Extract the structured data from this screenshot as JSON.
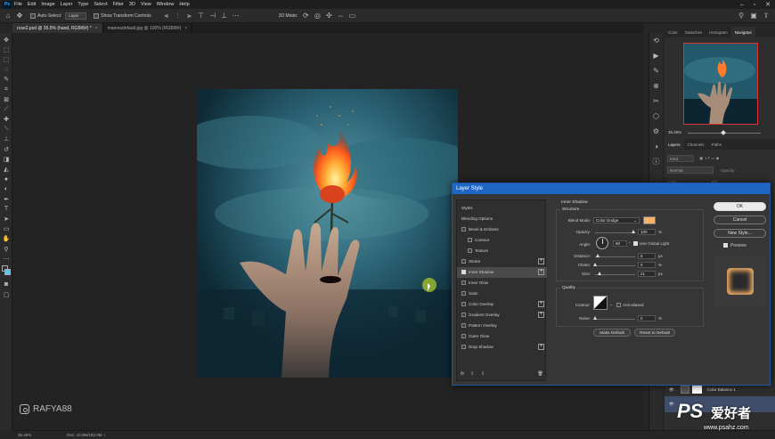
{
  "app": {
    "name": "Ps"
  },
  "menu": [
    "File",
    "Edit",
    "Image",
    "Layer",
    "Type",
    "Select",
    "Filter",
    "3D",
    "View",
    "Window",
    "Help"
  ],
  "options": {
    "auto_select": "Auto-Select:",
    "layer_select": "Layer",
    "transform": "Show Transform Controls",
    "mode3d": "3D Mode:"
  },
  "tabs": [
    {
      "label": "rose2.psd @ 35.5% (hand, RGB/8#) *"
    },
    {
      "label": "maxresdefault.jpg @ 100% (RGB/8#)"
    }
  ],
  "watermark": "RAFYA88",
  "status": {
    "zoom": "35.46%",
    "doc": "Doc: 10.9M/182.0M"
  },
  "panels": {
    "tabs": [
      "Color",
      "Swatches",
      "Histogram",
      "Navigator"
    ],
    "nav_zoom": "35.46%",
    "layer_tabs": [
      "Layers",
      "Channels",
      "Paths"
    ],
    "kind": "Kind",
    "blend": "Normal",
    "opacity_label": "Opacity:",
    "fill_label": "Fill:",
    "lock_label": "Lock:",
    "layer_name": "Color Balance 1"
  },
  "dialog": {
    "title": "Layer Style",
    "styles_header": "Styles",
    "styles": [
      {
        "label": "Blending Options",
        "check": false,
        "plus": false,
        "indent": 0,
        "has_cb": false
      },
      {
        "label": "Bevel & Emboss",
        "check": false,
        "plus": false,
        "indent": 0,
        "has_cb": true
      },
      {
        "label": "Contour",
        "check": false,
        "plus": false,
        "indent": 1,
        "has_cb": true
      },
      {
        "label": "Texture",
        "check": false,
        "plus": false,
        "indent": 1,
        "has_cb": true
      },
      {
        "label": "Stroke",
        "check": false,
        "plus": true,
        "indent": 0,
        "has_cb": true
      },
      {
        "label": "Inner Shadow",
        "check": true,
        "plus": true,
        "indent": 0,
        "has_cb": true,
        "selected": true
      },
      {
        "label": "Inner Glow",
        "check": false,
        "plus": false,
        "indent": 0,
        "has_cb": true
      },
      {
        "label": "Satin",
        "check": false,
        "plus": false,
        "indent": 0,
        "has_cb": true
      },
      {
        "label": "Color Overlay",
        "check": false,
        "plus": true,
        "indent": 0,
        "has_cb": true
      },
      {
        "label": "Gradient Overlay",
        "check": false,
        "plus": true,
        "indent": 0,
        "has_cb": true
      },
      {
        "label": "Pattern Overlay",
        "check": false,
        "plus": false,
        "indent": 0,
        "has_cb": true
      },
      {
        "label": "Outer Glow",
        "check": false,
        "plus": false,
        "indent": 0,
        "has_cb": true
      },
      {
        "label": "Drop Shadow",
        "check": false,
        "plus": true,
        "indent": 0,
        "has_cb": true
      }
    ],
    "section": "Inner Shadow",
    "structure": "Structure",
    "blend_mode_label": "Blend Mode:",
    "blend_mode": "Color Dodge",
    "shadow_color": "#f5b26b",
    "opacity_label": "Opacity:",
    "opacity": "100",
    "angle_label": "Angle:",
    "angle": "90",
    "global_light": "Use Global Light",
    "distance_label": "Distance:",
    "distance": "8",
    "choke_label": "Choke:",
    "choke": "0",
    "size_label": "Size:",
    "size": "21",
    "quality": "Quality",
    "contour_label": "Contour:",
    "antialiased": "Anti-aliased",
    "noise_label": "Noise:",
    "noise": "0",
    "pct": "%",
    "px": "px",
    "make_default": "Make Default",
    "reset_default": "Reset to Default",
    "ok": "OK",
    "cancel": "Cancel",
    "new_style": "New Style...",
    "preview": "Preview",
    "fx": "fx"
  },
  "site_logo": {
    "ps": "PS",
    "cn": "爱好者",
    "url": "www.psahz.com"
  }
}
